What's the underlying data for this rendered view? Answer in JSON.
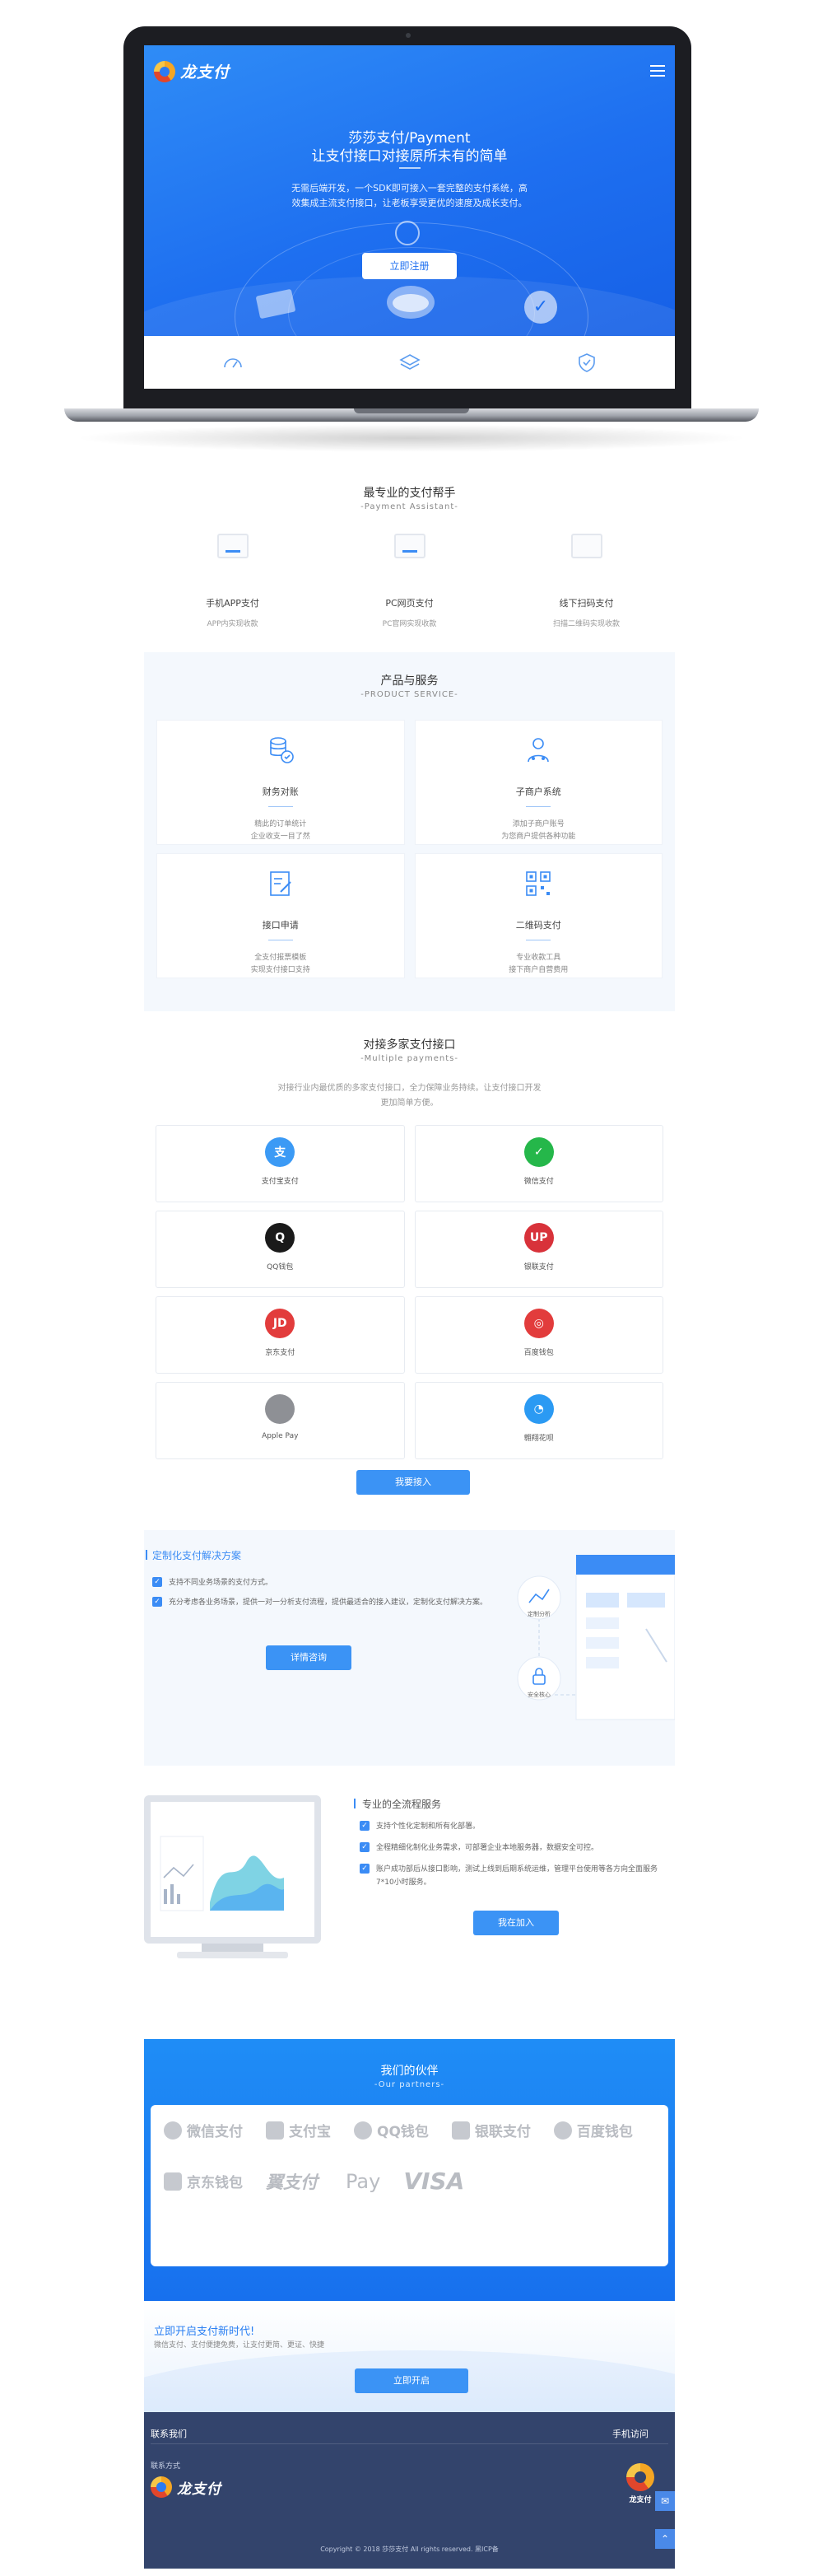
{
  "hero": {
    "brand": "龙支付",
    "title_line1": "莎莎支付/Payment",
    "title_line2": "让支付接口对接原所未有的简单",
    "description": "无需后端开发，一个SDK即可接入一套完整的支付系统，高效集成主流支付接口，让老板享受更优的速度及成长支付。",
    "register_button": "立即注册"
  },
  "assistant": {
    "title": "最专业的支付帮手",
    "subtitle": "-Payment Assistant-",
    "items": [
      {
        "name": "手机APP支付",
        "desc": "APP内实现收款"
      },
      {
        "name": "PC网页支付",
        "desc": "PC官网实现收款"
      },
      {
        "name": "线下扫码支付",
        "desc": "扫描二维码实现收款"
      }
    ]
  },
  "products": {
    "title": "产品与服务",
    "subtitle": "-PRODUCT SERVICE-",
    "items": [
      {
        "name": "财务对账",
        "icon": "coins-check-icon",
        "desc1": "精此的订单统计",
        "desc2": "企业收支一目了然"
      },
      {
        "name": "子商户系统",
        "icon": "user-group-icon",
        "desc1": "添加子商户账号",
        "desc2": "为您商户提供各种功能"
      },
      {
        "name": "接口申请",
        "icon": "document-edit-icon",
        "desc1": "全支付报票模板",
        "desc2": "实现支付接口支持"
      },
      {
        "name": "二维码支付",
        "icon": "qr-code-icon",
        "desc1": "专业收款工具",
        "desc2": "接下商户自营费用"
      }
    ]
  },
  "multi": {
    "title": "对接多家支付接口",
    "subtitle": "-Multiple payments-",
    "description": "对接行业内最优质的多家支付接口，全力保障业务持续。让支付接口开发更加简单方便。",
    "button": "我要接入",
    "items": [
      {
        "name": "支付宝支付",
        "icon": "alipay-icon",
        "glyph": "支",
        "color": "#3b9af5"
      },
      {
        "name": "微信支付",
        "icon": "wechat-icon",
        "glyph": "✓",
        "color": "#25b74a"
      },
      {
        "name": "QQ钱包",
        "icon": "qq-icon",
        "glyph": "Q",
        "color": "#1a1a1a"
      },
      {
        "name": "银联支付",
        "icon": "unionpay-icon",
        "glyph": "UP",
        "color": "#d8323a"
      },
      {
        "name": "京东支付",
        "icon": "jd-icon",
        "glyph": "JD",
        "color": "#e23c3c"
      },
      {
        "name": "百度钱包",
        "icon": "baidu-wallet-icon",
        "glyph": "◎",
        "color": "#e23c3c"
      },
      {
        "name": "Apple Pay",
        "icon": "apple-icon",
        "glyph": "",
        "color": "#8e9095"
      },
      {
        "name": "翱翔花呗",
        "icon": "huabei-icon",
        "glyph": "◔",
        "color": "#2b9af3"
      }
    ]
  },
  "custom": {
    "title": "定制化支付解决方案",
    "items": [
      "支持不同业务场景的支付方式。",
      "充分考虑各业务场景，提供一对一分析支付流程，提供最适合的接入建议，定制化支付解决方案。"
    ],
    "button": "详情咨询",
    "deco_labels": [
      "定制分析",
      "安全核心"
    ]
  },
  "process": {
    "title": "专业的全流程服务",
    "items": [
      "支持个性化定制和所有化部署。",
      "全程精细化制化业务需求，可部署企业本地服务器，数据安全可控。",
      "账户成功部后从接口影响，测试上线到后期系统运维，管理平台使用等各方向全面服务 7*10小时服务。"
    ],
    "button": "我在加入"
  },
  "partners": {
    "title": "我们的伙伴",
    "subtitle": "-Our partners-",
    "row1": [
      "微信支付",
      "支付宝",
      "QQ钱包",
      "银联支付",
      "百度钱包"
    ],
    "row2": [
      "京东钱包",
      "翼支付",
      "Pay",
      "VISA"
    ]
  },
  "cta": {
    "title": "立即开启支付新时代!",
    "subtitle": "微信支付、支付便捷免费，让支付更简、更证、快捷",
    "button": "立即开启"
  },
  "footer": {
    "contact_heading": "联系我们",
    "mobile_heading": "手机访问",
    "contact_label": "联系方式",
    "brand": "龙支付",
    "brand_short": "龙支付",
    "copyright": "Copyright © 2018 莎莎支付 All rights reserved. 黑ICP备",
    "side_icons": [
      "chat-icon",
      "up-arrow-icon"
    ]
  }
}
